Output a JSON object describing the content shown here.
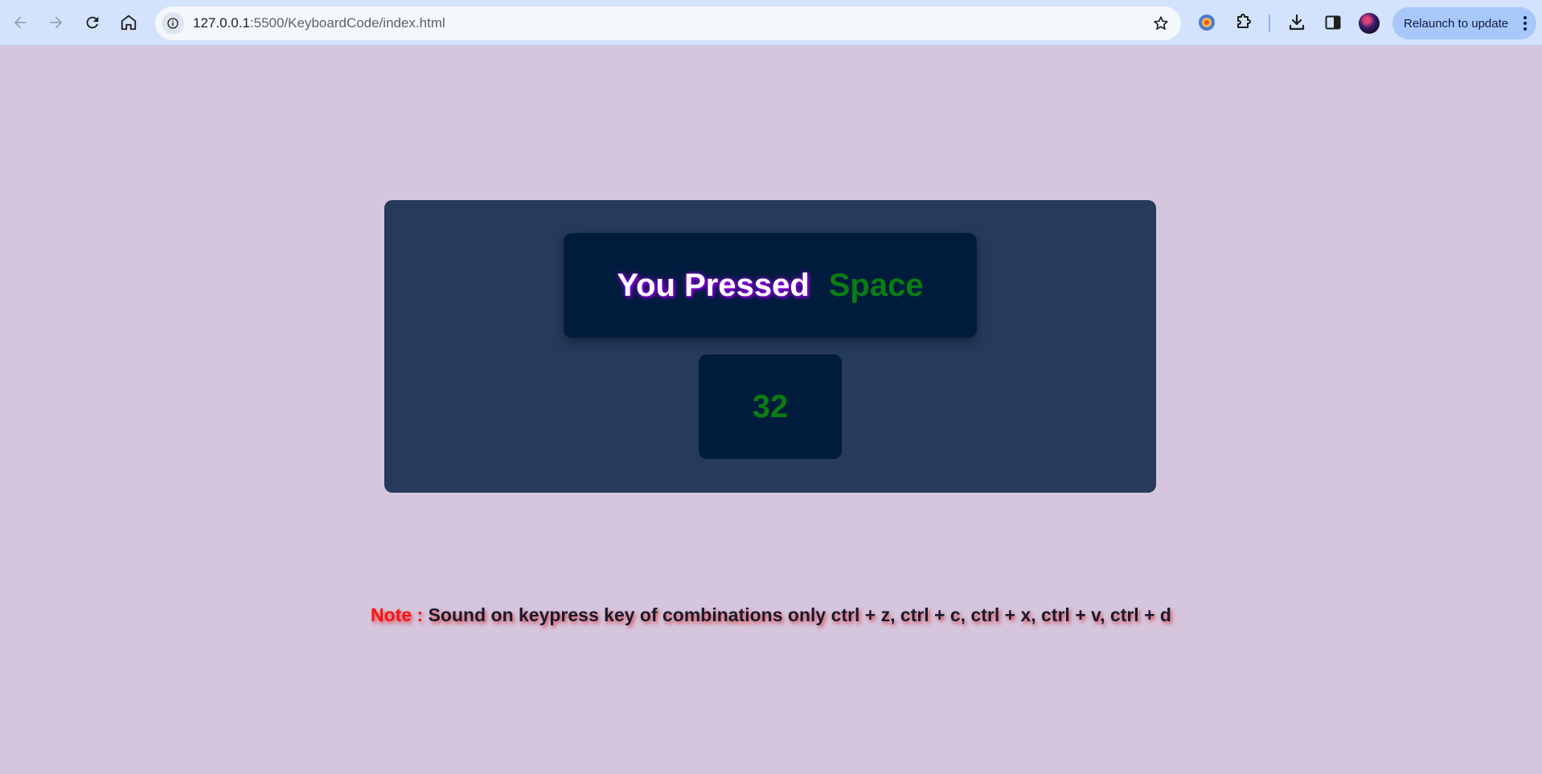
{
  "browser": {
    "url_host": "127.0.0.1",
    "url_rest": ":5500/KeyboardCode/index.html",
    "relaunch_label": "Relaunch to update",
    "nav_icons": [
      "back-arrow-icon",
      "forward-arrow-icon",
      "reload-icon",
      "home-icon"
    ],
    "toolbar_icons": [
      "extension-icon",
      "puzzle-icon",
      "download-icon",
      "side-panel-icon"
    ]
  },
  "page": {
    "pressed_label": "You Pressed",
    "pressed_key": "Space",
    "key_code": "32",
    "note_prefix": "Note :",
    "note_text": "Sound on keypress key of combinations only ctrl + z, ctrl + c, ctrl + x, ctrl + v, ctrl + d"
  },
  "colors": {
    "background": "#d5c5dd",
    "panel": "#263a5b",
    "box": "#001c3d",
    "key_green": "#0a7d12",
    "note_red": "#ff1111"
  }
}
